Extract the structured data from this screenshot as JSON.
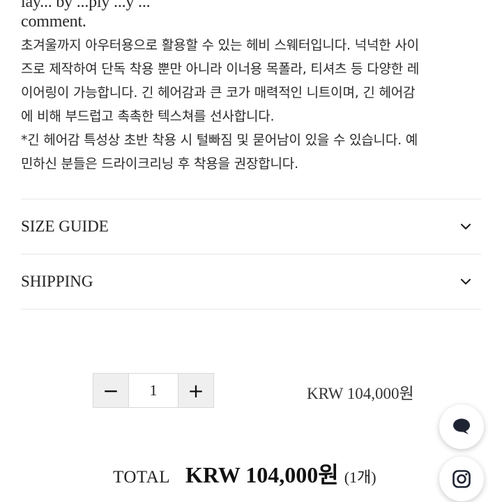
{
  "description": {
    "partial_top_line": "lay... by ...ply ...y ...",
    "lines": [
      "comment.",
      "초겨울까지 아우터용으로 활용할 수 있는 헤비 스웨터입니다. 넉넉한 사이",
      "즈로 제작하여 단독 착용 뿐만 아니라 이너용 목폴라, 티셔츠 등 다양한 레",
      "이어링이 가능합니다. 긴 헤어감과 큰 코가 매력적인 니트이며, 긴 헤어감",
      "에 비해 부드럽고 촉촉한 텍스쳐를 선사합니다.",
      "*긴 헤어감 특성상 초반 착용 시 털빠짐 및 묻어남이 있을 수 있습니다. 예",
      "민하신 분들은 드라이크리닝 후 착용을 권장합니다."
    ]
  },
  "accordion": [
    {
      "label": "SIZE GUIDE",
      "icon": "chevron-down-icon"
    },
    {
      "label": "SHIPPING",
      "icon": "chevron-down-icon"
    }
  ],
  "quantity": {
    "minus_label": "−",
    "plus_label": "+",
    "value": "1"
  },
  "item_price": "KRW 104,000원",
  "total": {
    "label": "TOTAL",
    "price": "KRW 104,000원",
    "count": "(1개)"
  },
  "floating_buttons": [
    {
      "name": "chat",
      "icon": "chat-bubble-icon"
    },
    {
      "name": "instagram",
      "icon": "instagram-icon"
    }
  ],
  "colors": {
    "text": "#222222",
    "divider": "#e6e6e6",
    "qty_button_bg": "#efefef"
  }
}
